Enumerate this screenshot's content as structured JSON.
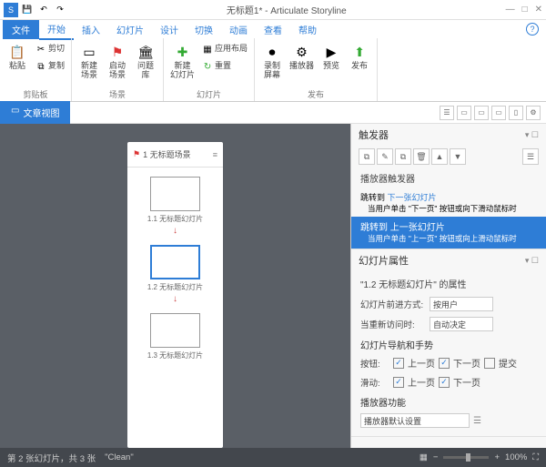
{
  "title": "无标题1* - Articulate Storyline",
  "menu": {
    "file": "文件",
    "start": "开始",
    "insert": "插入",
    "slides": "幻灯片",
    "design": "设计",
    "transition": "切换",
    "anim": "动画",
    "view": "查看",
    "help": "帮助"
  },
  "ribbon": {
    "g1": {
      "name": "剪贴板",
      "paste": "粘贴",
      "cut": "剪切",
      "copy": "复制"
    },
    "g2": {
      "name": "场景",
      "new": "新建\n场景",
      "start": "启动\n场景",
      "qbank": "问题\n库"
    },
    "g3": {
      "name": "幻灯片",
      "new": "新建\n幻灯片",
      "layout": "应用布局",
      "reset": "重置"
    },
    "g4": {
      "name": "发布",
      "record": "录制\n屏幕",
      "player": "播放器",
      "preview": "预览",
      "publish": "发布"
    }
  },
  "docTab": "文章视图",
  "scene": {
    "title": "1 无标题场景",
    "s1": "1.1 无标题幻灯片",
    "s2": "1.2 无标题幻灯片",
    "s3": "1.3 无标题幻灯片"
  },
  "triggers": {
    "header": "触发器",
    "group": "播放器触发器",
    "t1": {
      "jump": "跳转到",
      "target": "下一张幻灯片",
      "when": "当用户单击 \"下一页\" 按钮或向下滑动鼠标时"
    },
    "t2": {
      "jump": "跳转到",
      "target": "上一张幻灯片",
      "when": "当用户单击 \"上一页\" 按钮或向上滑动鼠标时"
    }
  },
  "props": {
    "header": "幻灯片属性",
    "title": "\"1.2 无标题幻灯片\" 的属性",
    "advance": {
      "label": "幻灯片前进方式:",
      "value": "按用户"
    },
    "revisit": {
      "label": "当重新访问时:",
      "value": "自动决定"
    },
    "nav": {
      "label": "幻灯片导航和手势",
      "btns": "按钮:",
      "swipe": "滑动:",
      "prev": "上一页",
      "next": "下一页",
      "submit": "提交"
    },
    "player": {
      "label": "播放器功能",
      "default": "播放器默认设置"
    }
  },
  "status": {
    "pos": "第 2 张幻灯片，共 3 张",
    "layout": "\"Clean\"",
    "zoom": "100%"
  }
}
